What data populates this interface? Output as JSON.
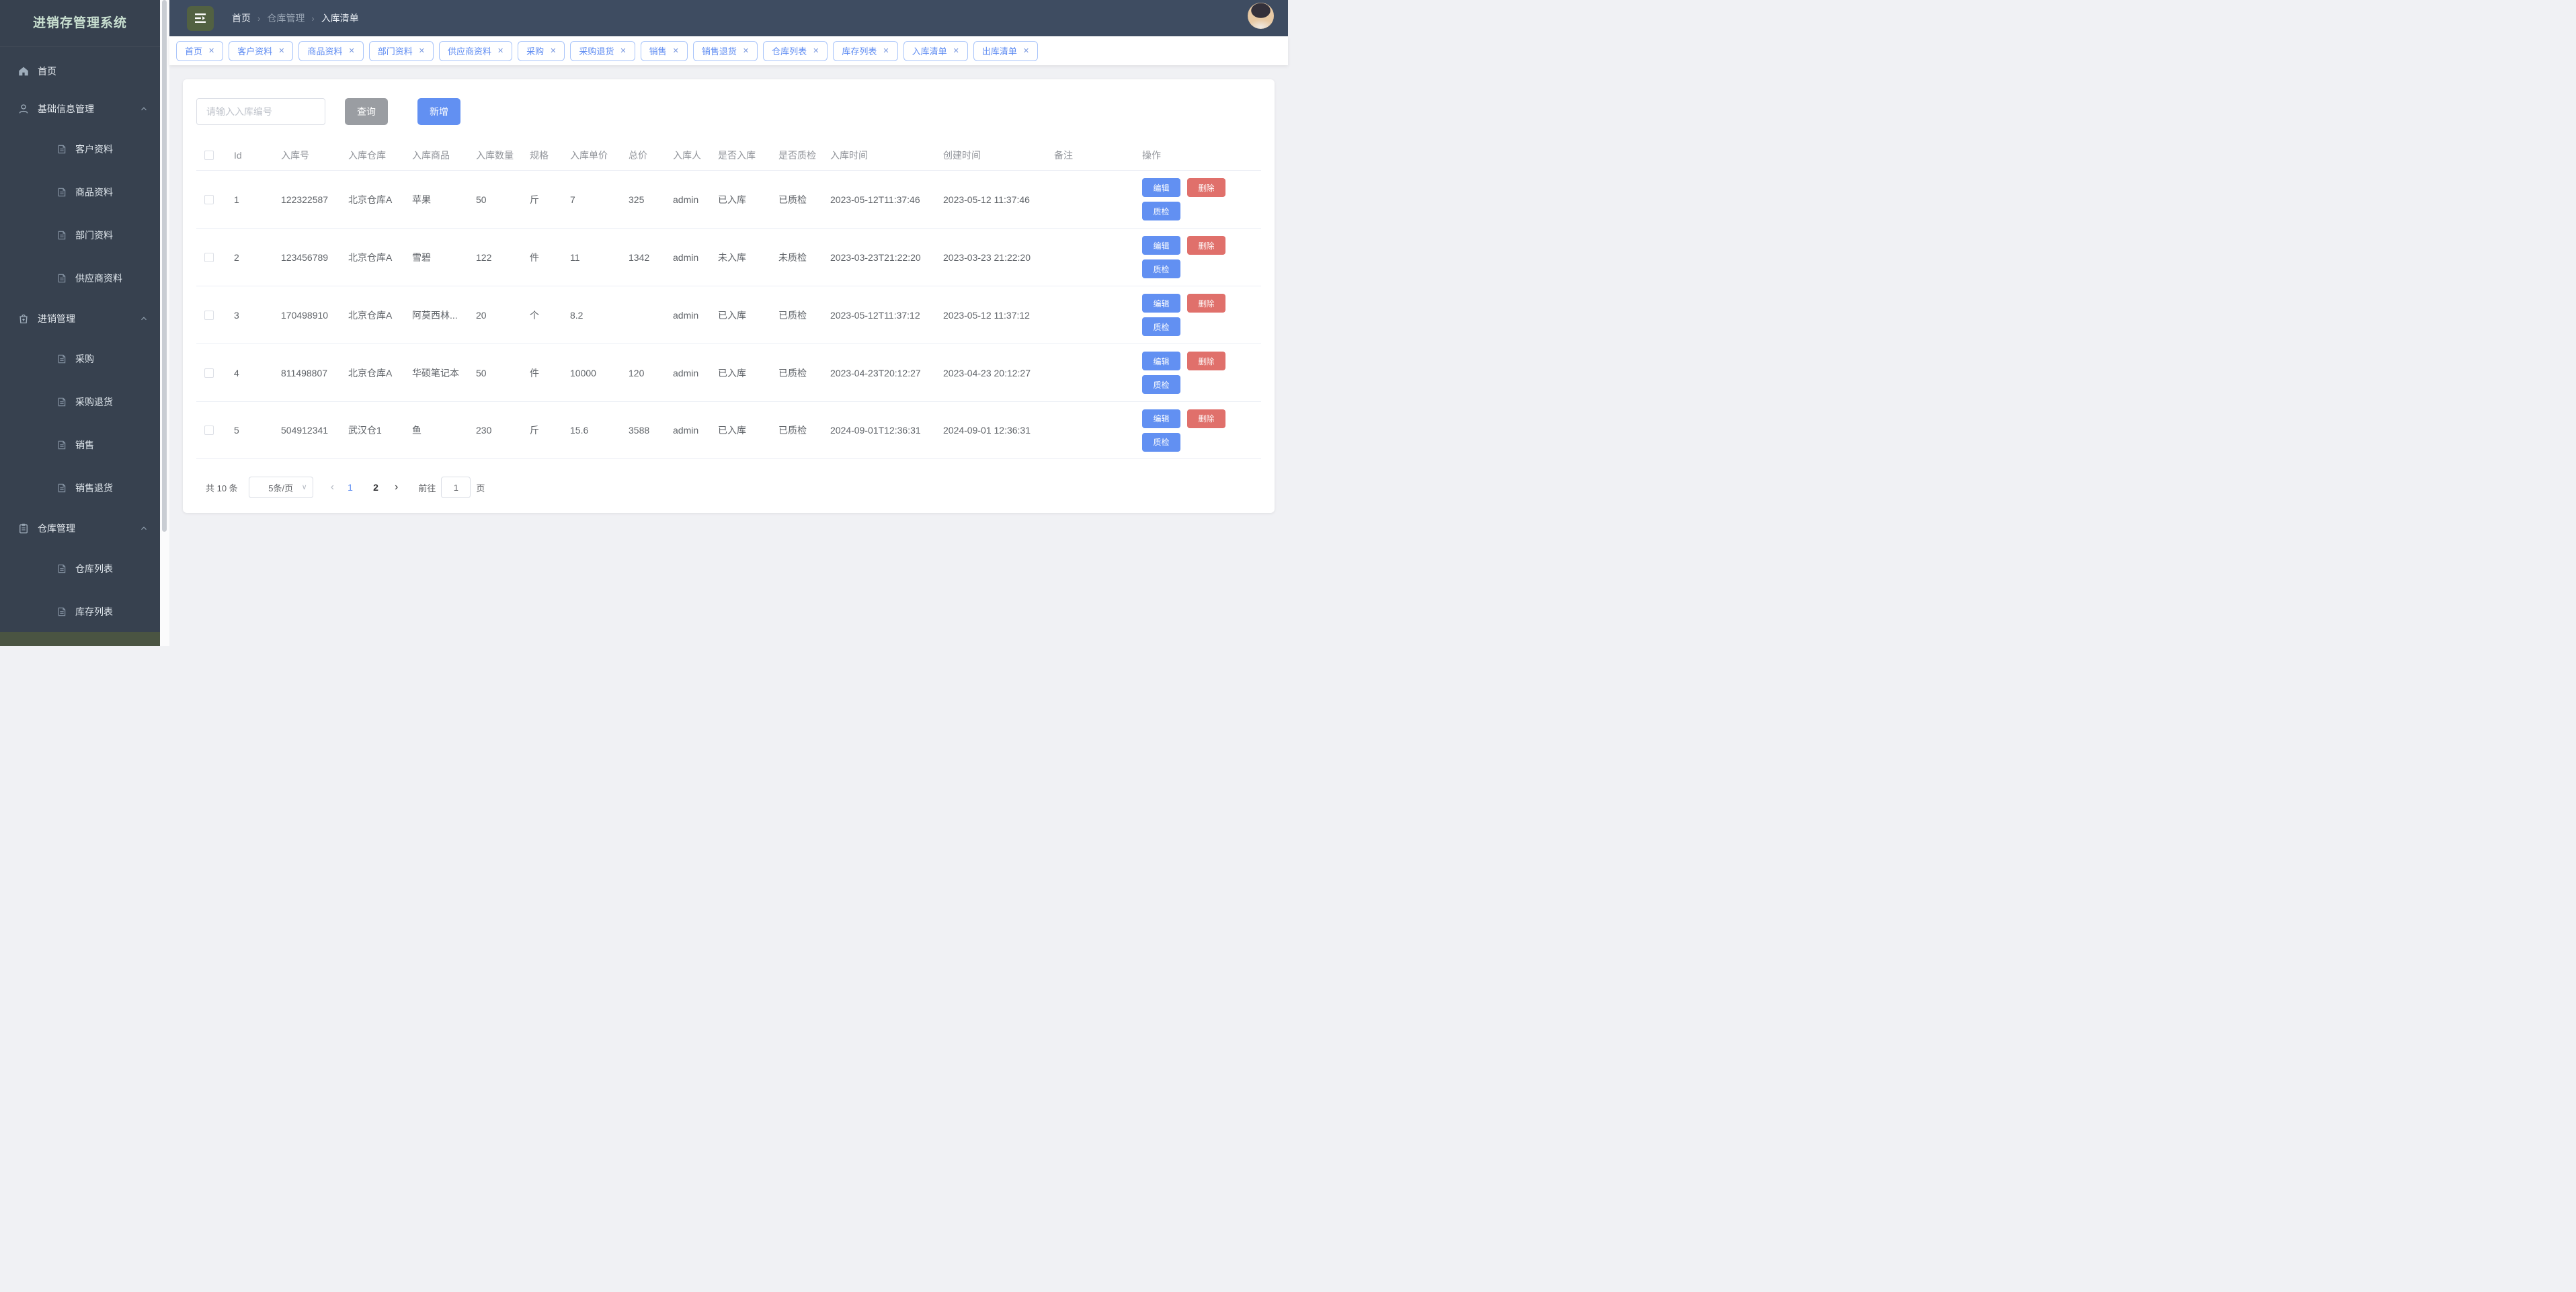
{
  "colors": {
    "primary": "#6290f2",
    "danger": "#e0706b",
    "toolbar_gray": "#9a9da2",
    "hamburger_green": "#526142",
    "sidebar_bg": "#37414f",
    "header_bg": "#3e4c61",
    "active_item_green": "#4a5442",
    "title_text": "#c8dfd0"
  },
  "icons": {
    "hamburger": "collapse-menu",
    "home": "house",
    "base_info_group": "user",
    "trade_group": "shopping-bag",
    "warehouse_group": "clipboard",
    "submenu_item": "document",
    "group_state": "chevron-up",
    "breadcrumb_separator": "›",
    "tab_close": "✕",
    "select_caret": "∨",
    "pager_prev": "‹",
    "pager_next": "›"
  },
  "sidebar": {
    "title": "进销存管理系统",
    "home": "首页",
    "groups": [
      {
        "label": "基础信息管理",
        "children": [
          "客户资料",
          "商品资料",
          "部门资料",
          "供应商资料"
        ]
      },
      {
        "label": "进销管理",
        "children": [
          "采购",
          "采购退货",
          "销售",
          "销售退货"
        ]
      },
      {
        "label": "仓库管理",
        "children": [
          "仓库列表",
          "库存列表"
        ]
      }
    ]
  },
  "header": {
    "breadcrumb": [
      "首页",
      "仓库管理",
      "入库清单"
    ]
  },
  "tabs": [
    "首页",
    "客户资料",
    "商品资料",
    "部门资料",
    "供应商资料",
    "采购",
    "采购退货",
    "销售",
    "销售退货",
    "仓库列表",
    "库存列表",
    "入库清单",
    "出库清单"
  ],
  "toolbar": {
    "search_placeholder": "请输入入库编号",
    "search_label": "查询",
    "add_label": "新增"
  },
  "table": {
    "columns": [
      "Id",
      "入库号",
      "入库仓库",
      "入库商品",
      "入库数量",
      "规格",
      "入库单价",
      "总价",
      "入库人",
      "是否入库",
      "是否质检",
      "入库时间",
      "创建时间",
      "备注",
      "操作"
    ],
    "actions": {
      "edit": "编辑",
      "delete": "删除",
      "qc": "质检"
    },
    "rows": [
      {
        "cells": [
          "1",
          "122322587",
          "北京仓库A",
          "苹果",
          "50",
          "斤",
          "7",
          "325",
          "admin",
          "已入库",
          "已质检",
          "2023-05-12T11:37:46",
          "2023-05-12 11:37:46",
          ""
        ]
      },
      {
        "cells": [
          "2",
          "123456789",
          "北京仓库A",
          "雪碧",
          "122",
          "件",
          "11",
          "1342",
          "admin",
          "未入库",
          "未质检",
          "2023-03-23T21:22:20",
          "2023-03-23 21:22:20",
          ""
        ]
      },
      {
        "cells": [
          "3",
          "170498910",
          "北京仓库A",
          "阿莫西林...",
          "20",
          "个",
          "8.2",
          "",
          "admin",
          "已入库",
          "已质检",
          "2023-05-12T11:37:12",
          "2023-05-12 11:37:12",
          ""
        ]
      },
      {
        "cells": [
          "4",
          "811498807",
          "北京仓库A",
          "华硕笔记本",
          "50",
          "件",
          "10000",
          "120",
          "admin",
          "已入库",
          "已质检",
          "2023-04-23T20:12:27",
          "2023-04-23 20:12:27",
          ""
        ]
      },
      {
        "cells": [
          "5",
          "504912341",
          "武汉仓1",
          "鱼",
          "230",
          "斤",
          "15.6",
          "3588",
          "admin",
          "已入库",
          "已质检",
          "2024-09-01T12:36:31",
          "2024-09-01 12:36:31",
          ""
        ]
      }
    ]
  },
  "pagination": {
    "total": "共 10 条",
    "page_size": "5条/页",
    "pages": [
      "1",
      "2"
    ],
    "goto_label": "前往",
    "goto_value": "1",
    "goto_suffix": "页"
  }
}
